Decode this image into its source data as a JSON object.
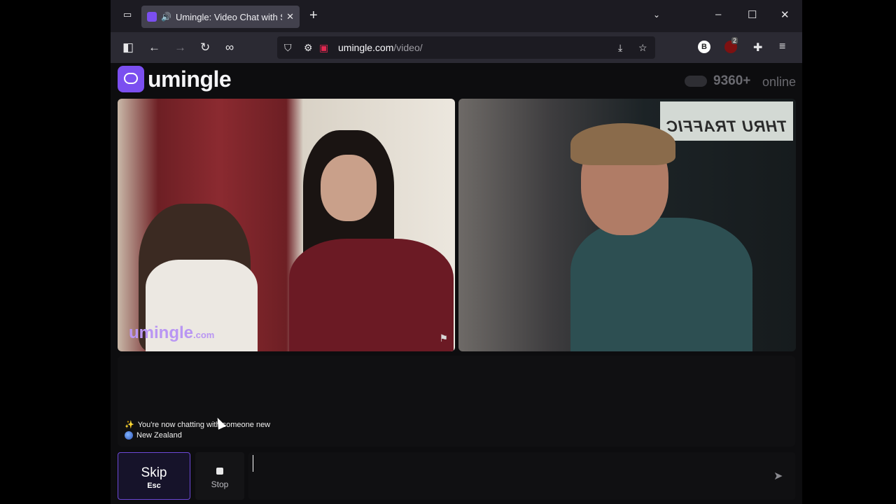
{
  "browser": {
    "tab_title": "Umingle: Video Chat with S",
    "url_domain": "umingle.com",
    "url_path": "/video/",
    "ublock_count": "2",
    "profile_badge": "B"
  },
  "site": {
    "logo_text": "umingle",
    "online_count": "9360+",
    "online_label": "online",
    "watermark": "umingle",
    "watermark_suffix": ".com"
  },
  "chat": {
    "status_message": "You're now chatting with someone new",
    "status_emoji": "✨",
    "country": "New Zealand",
    "input_value": ""
  },
  "controls": {
    "skip_label": "Skip",
    "skip_key": "Esc",
    "stop_label": "Stop"
  },
  "video": {
    "remote_sign_text": "THRU TRAFFIC"
  },
  "colors": {
    "brand": "#7b4ff0",
    "background": "#0d0d0f"
  }
}
